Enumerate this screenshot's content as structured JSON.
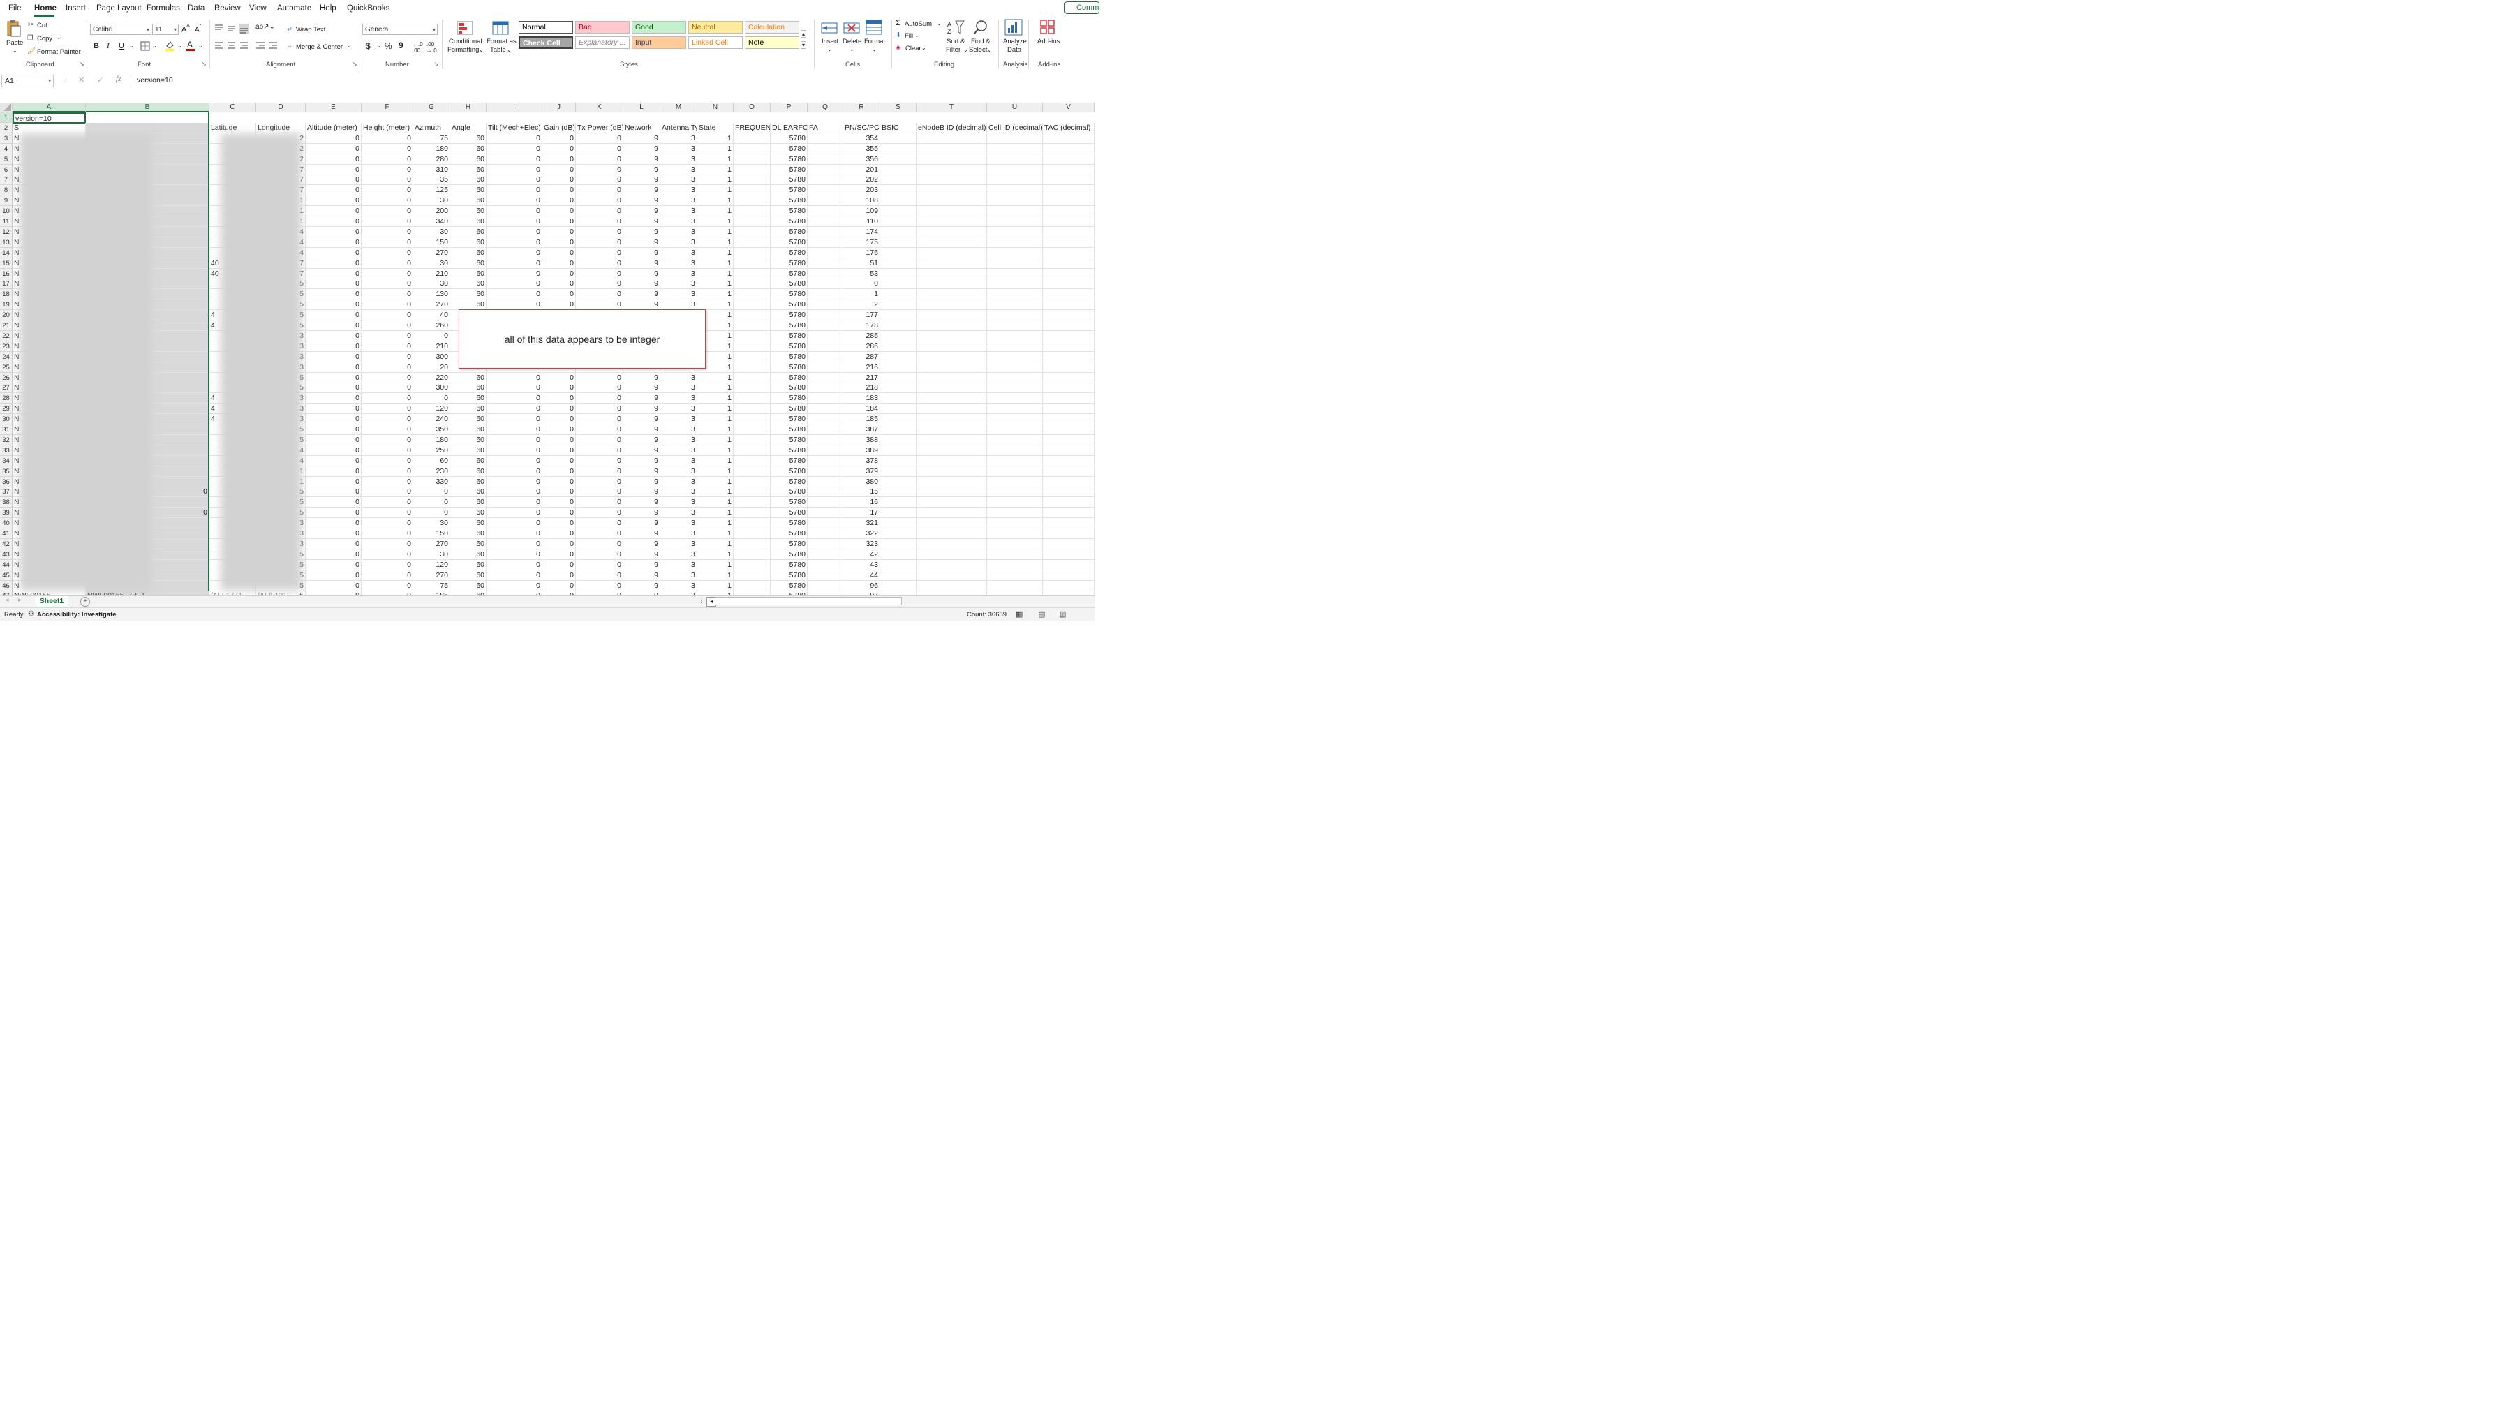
{
  "menu": {
    "tabs": [
      "File",
      "Home",
      "Insert",
      "Page Layout",
      "Formulas",
      "Data",
      "Review",
      "View",
      "Automate",
      "Help",
      "QuickBooks"
    ],
    "active": "Home",
    "comments_label": "Comm"
  },
  "ribbon": {
    "clipboard": {
      "paste": "Paste",
      "cut": "Cut",
      "copy": "Copy",
      "format_painter": "Format Painter",
      "label": "Clipboard"
    },
    "font": {
      "name": "Calibri",
      "size": "11",
      "label": "Font",
      "bold": "B",
      "italic": "I",
      "underline": "U"
    },
    "alignment": {
      "wrap": "Wrap Text",
      "merge": "Merge & Center",
      "label": "Alignment"
    },
    "number": {
      "format": "General",
      "currency": "$",
      "percent": "%",
      "comma": "9",
      "label": "Number"
    },
    "cond_format": [
      "Conditional",
      "Formatting"
    ],
    "format_table": [
      "Format as",
      "Table"
    ],
    "styles": {
      "label": "Styles",
      "row1": [
        {
          "text": "Normal",
          "bg": "#ffffff",
          "fg": "#000000"
        },
        {
          "text": "Bad",
          "bg": "#ffc7ce",
          "fg": "#9c0006"
        },
        {
          "text": "Good",
          "bg": "#c6efce",
          "fg": "#006100"
        },
        {
          "text": "Neutral",
          "bg": "#ffeb9c",
          "fg": "#9c5700"
        },
        {
          "text": "Calculation",
          "bg": "#f2f2f2",
          "fg": "#fa7d00"
        }
      ],
      "row2": [
        {
          "text": "Check Cell",
          "bg": "#a5a5a5",
          "fg": "#ffffff"
        },
        {
          "text": "Explanatory ...",
          "bg": "#ffffff",
          "fg": "#7f7f7f"
        },
        {
          "text": "Input",
          "bg": "#ffcc99",
          "fg": "#3f3f76"
        },
        {
          "text": "Linked Cell",
          "bg": "#ffffff",
          "fg": "#fa7d00"
        },
        {
          "text": "Note",
          "bg": "#ffffcc",
          "fg": "#000000"
        }
      ]
    },
    "cells": {
      "insert": "Insert",
      "delete": "Delete",
      "format": "Format",
      "label": "Cells"
    },
    "editing": {
      "autosum": "AutoSum",
      "fill": "Fill",
      "clear": "Clear",
      "sort": [
        "Sort &",
        "Filter"
      ],
      "find": [
        "Find &",
        "Select"
      ],
      "label": "Editing"
    },
    "analysis": {
      "analyze": [
        "Analyze",
        "Data"
      ],
      "label": "Analysis"
    },
    "addins": {
      "addins": "Add-ins",
      "label": "Add-ins"
    }
  },
  "formula": {
    "namebox": "A1",
    "fx": "fx",
    "content": "version=10"
  },
  "columns": [
    "A",
    "B",
    "C",
    "D",
    "E",
    "F",
    "G",
    "H",
    "I",
    "J",
    "K",
    "L",
    "M",
    "N",
    "O",
    "P",
    "Q",
    "R",
    "S",
    "T",
    "U",
    "V"
  ],
  "row1_a1": "version=10",
  "row2_headers": {
    "A": "S",
    "C": "Latitude",
    "D": "Longitude",
    "E": "Altitude (meter)",
    "F": "Height (meter)",
    "G": "Azimuth",
    "H": "Angle",
    "I": "Tilt (Mech+Elec)",
    "J": "Gain (dB)",
    "K": "Tx Power (dB)",
    "L": "Network",
    "M": "Antenna Ty",
    "N": "State",
    "O": "FREQUENC",
    "P": "DL EARFCN",
    "Q": "FA",
    "R": "PN/SC/PCI",
    "S": "BSIC",
    "T": "eNodeB ID (decimal)",
    "U": "Cell ID (decimal)",
    "V": "TAC (decimal)"
  },
  "row_numbers": [
    1,
    2,
    3,
    4,
    5,
    6,
    7,
    8,
    9,
    10,
    11,
    12,
    13,
    14,
    15,
    16,
    17,
    18,
    19,
    20,
    21,
    22,
    23,
    24,
    25,
    26,
    27,
    28,
    29,
    30,
    31,
    32,
    33,
    34,
    35,
    36,
    37,
    38,
    39,
    40,
    41,
    42,
    43,
    44,
    45,
    46,
    47
  ],
  "azimuth": [
    75,
    180,
    280,
    310,
    35,
    125,
    30,
    200,
    340,
    30,
    150,
    270,
    30,
    210,
    30,
    130,
    270,
    40,
    260,
    0,
    210,
    300,
    20,
    220,
    300,
    0,
    120,
    240,
    350,
    180,
    250,
    60,
    230,
    330,
    0,
    0,
    0,
    30,
    150,
    270,
    30,
    120,
    270,
    75,
    185
  ],
  "pci": [
    354,
    355,
    356,
    201,
    202,
    203,
    108,
    109,
    110,
    174,
    175,
    176,
    51,
    53,
    0,
    1,
    2,
    177,
    178,
    285,
    286,
    287,
    216,
    217,
    218,
    183,
    184,
    185,
    387,
    388,
    389,
    378,
    379,
    380,
    15,
    16,
    17,
    321,
    322,
    323,
    42,
    43,
    44,
    96,
    97
  ],
  "constants": {
    "altitude": "0",
    "height": "0",
    "angle": "60",
    "tilt": "0",
    "gain": "0",
    "tx": "0",
    "network": "9",
    "antenna": "3",
    "state": "1",
    "earfcn": "5780"
  },
  "partial_edge": {
    "col_a": "N",
    "row47_a": "NWL00155",
    "row47_b": "NWL00155_7B_1",
    "row47_c": "/ALL1771",
    "row47_d": "/AL/L1212",
    "latitude_frag": {
      "15": "40",
      "16": "40",
      "20": "4",
      "21": "4",
      "28": "4",
      "29": "4",
      "30": "4"
    },
    "b_frag": {
      "37": "0",
      "39": "0"
    },
    "d_digits": [
      "2",
      "2",
      "2",
      "7",
      "7",
      "7",
      "1",
      "1",
      "1",
      "4",
      "4",
      "4",
      "7",
      "7",
      "5",
      "5",
      "5",
      "5",
      "5",
      "3",
      "3",
      "3",
      "3",
      "5",
      "5",
      "3",
      "3",
      "3",
      "5",
      "5",
      "4",
      "4",
      "1",
      "1",
      "5",
      "5",
      "5",
      "3",
      "3",
      "3",
      "5",
      "5",
      "5",
      "5",
      "5"
    ]
  },
  "callout": "all of this data appears to be integer",
  "sheet": {
    "name": "Sheet1",
    "add": "+"
  },
  "status": {
    "ready": "Ready",
    "accessibility": "Accessibility: Investigate",
    "count": "Count: 36659"
  }
}
